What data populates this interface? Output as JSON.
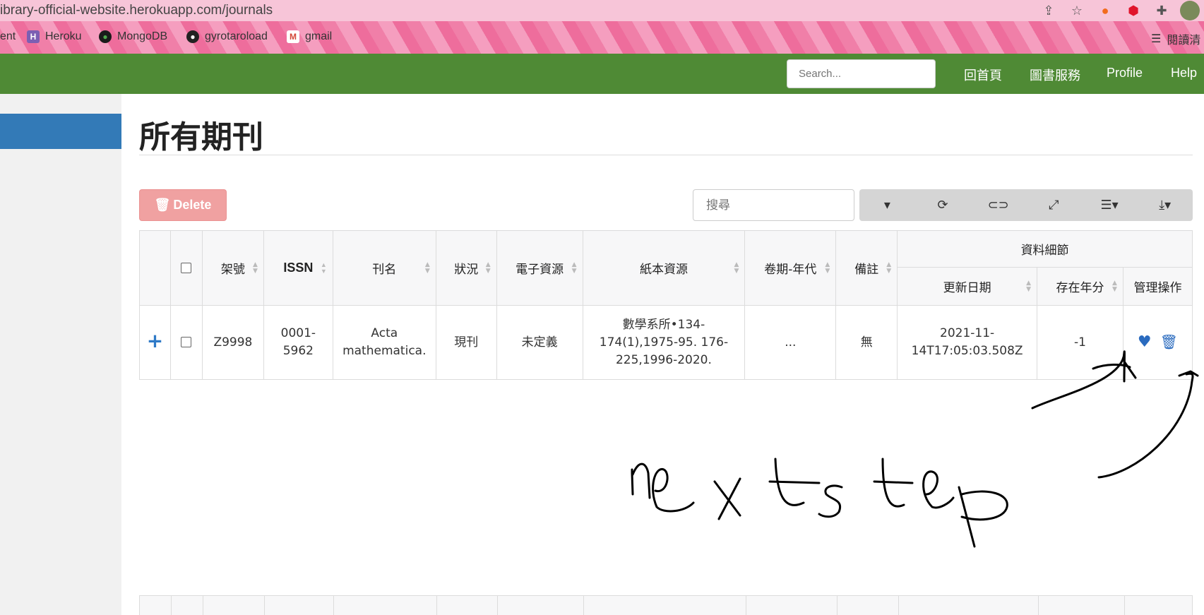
{
  "browser": {
    "url": "ibrary-official-website.herokuapp.com/journals",
    "bookmarks": [
      {
        "label": "ent"
      },
      {
        "label": "Heroku"
      },
      {
        "label": "MongoDB"
      },
      {
        "label": "gyrotaroload"
      },
      {
        "label": "gmail"
      },
      {
        "label": "閱讀清"
      }
    ]
  },
  "navbar": {
    "search_placeholder": "Search...",
    "links": [
      "回首頁",
      "圖書服務",
      "Profile",
      "Help"
    ]
  },
  "page": {
    "title": "所有期刊",
    "delete_label": "Delete",
    "table_search_placeholder": "搜尋"
  },
  "table": {
    "group_header": "資料細節",
    "columns": [
      "架號",
      "ISSN",
      "刊名",
      "狀況",
      "電子資源",
      "紙本資源",
      "卷期-年代",
      "備註",
      "更新日期",
      "存在年分",
      "管理操作"
    ],
    "rows": [
      {
        "shelf": "Z9998",
        "issn": "0001-\n5962",
        "title": "Acta\nmathematica.",
        "status": "現刊",
        "electronic": "未定義",
        "print": "數學系所•134-\n174(1),1975-95. 176-\n225,1996-2020.",
        "volume": "...",
        "note": "無",
        "updated": "2021-11-\n14T17:05:03.508Z",
        "years": "-1"
      }
    ]
  },
  "annotation": {
    "handwritten_text": "nextstep"
  }
}
